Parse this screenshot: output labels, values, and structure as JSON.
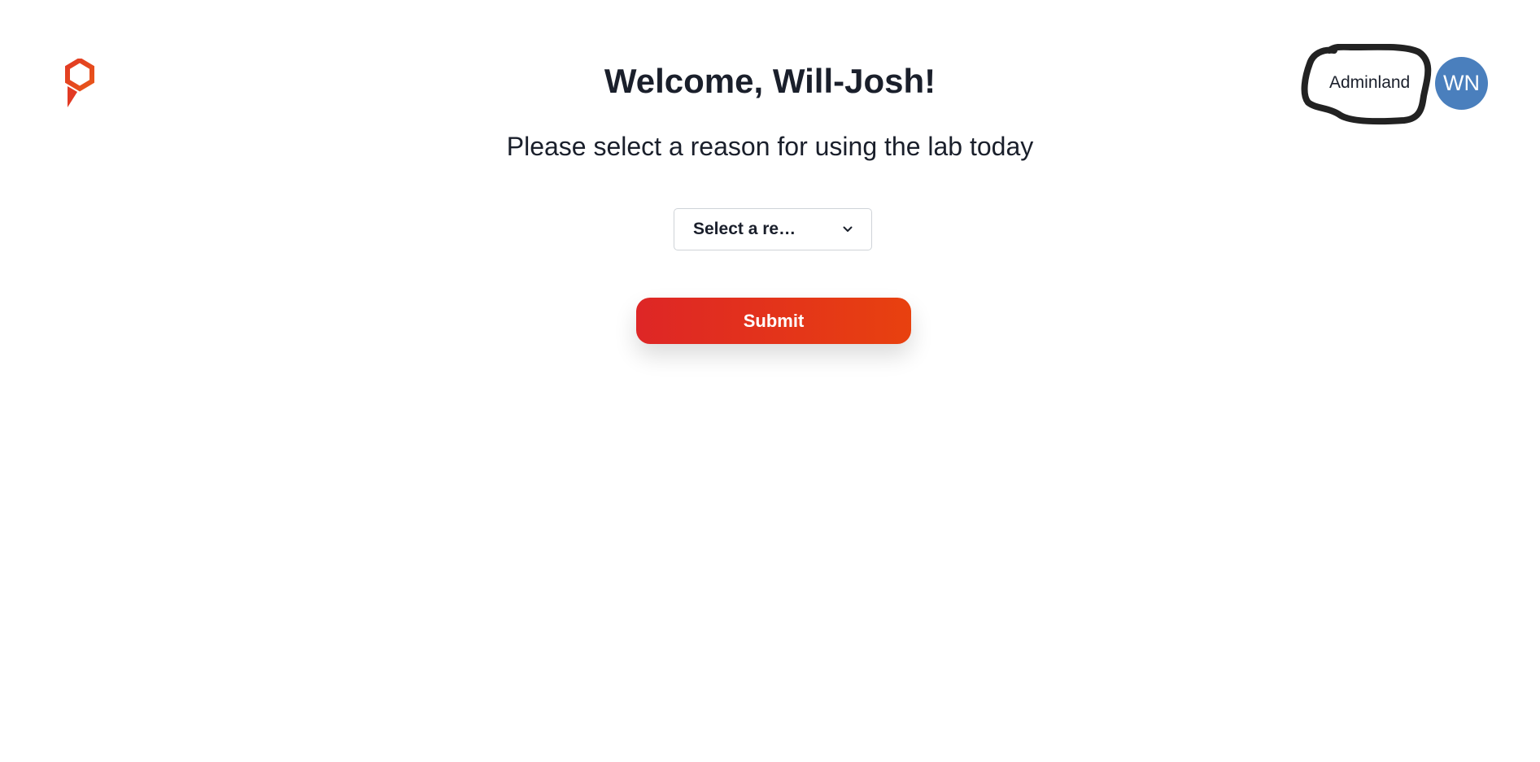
{
  "header": {
    "logo_icon": "hexagon-pin-logo",
    "title": "Welcome, Will-Josh!",
    "admin_link": "Adminland",
    "avatar_initials": "WN",
    "avatar_color": "#4a7fbd"
  },
  "main": {
    "prompt": "Please select a reason for using the lab today",
    "reason_select": {
      "selected_value": "Select a re…",
      "icon": "chevron-down-icon"
    },
    "submit_label": "Submit"
  },
  "colors": {
    "brand_red": "#de2626",
    "brand_orange": "#e8410f",
    "text_dark": "#1a1f2b"
  }
}
